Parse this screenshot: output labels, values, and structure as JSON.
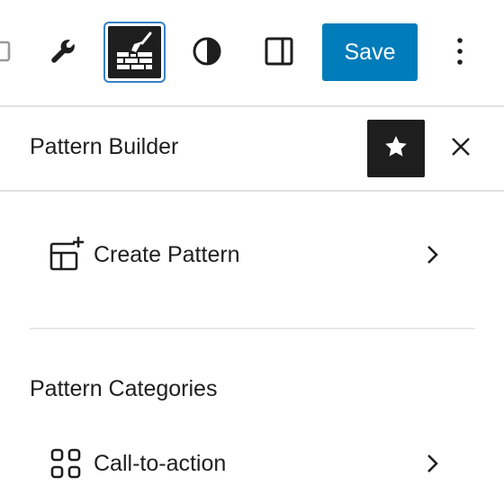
{
  "toolbar": {
    "partial_icon": "block-inserter-icon",
    "tools_icon": "wrench-icon",
    "builder_icon": "trowel-bricks-icon",
    "styles_icon": "half-circle-icon",
    "settings_icon": "sidebar-icon",
    "save_label": "Save",
    "more_icon": "kebab-menu-icon"
  },
  "panel": {
    "title": "Pattern Builder",
    "pin_icon": "star-icon",
    "close_icon": "close-icon",
    "create_item": {
      "label": "Create Pattern",
      "icon": "add-template-icon"
    },
    "categories_heading": "Pattern Categories",
    "categories": [
      {
        "label": "Call-to-action",
        "icon": "grid-icon"
      }
    ]
  },
  "colors": {
    "accent": "#007cba",
    "focus_ring": "#3582c4",
    "dark": "#1e1e1e",
    "divider": "#e0e0e0"
  }
}
